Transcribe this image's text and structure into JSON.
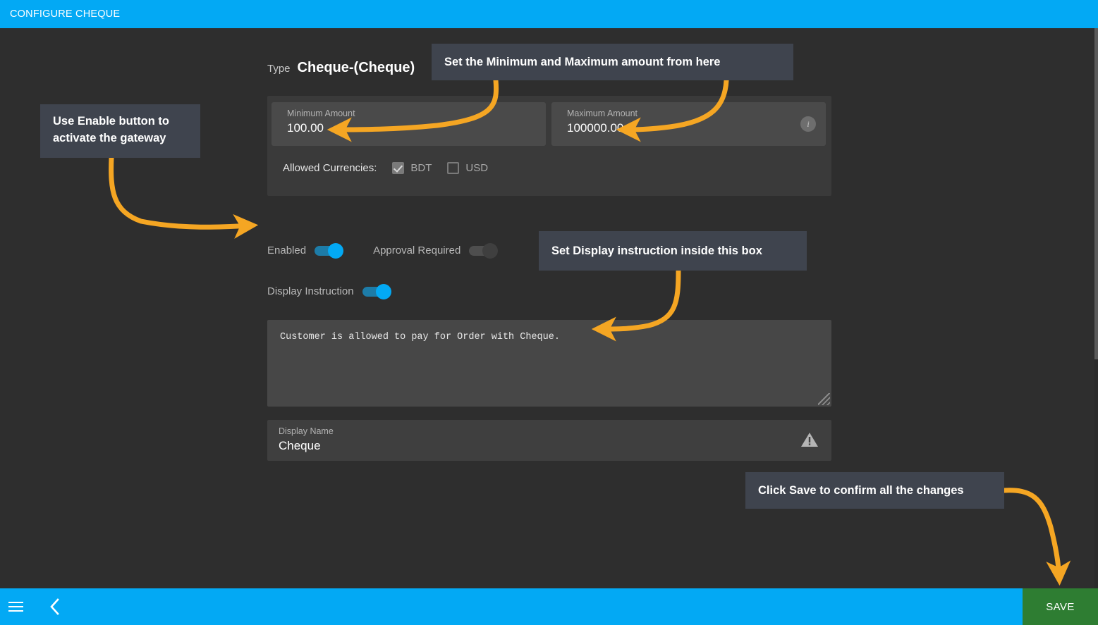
{
  "topbar": {
    "title": "CONFIGURE CHEQUE"
  },
  "form": {
    "type_label": "Type",
    "type_value": "Cheque-(Cheque)",
    "minimum": {
      "label": "Minimum Amount",
      "value": "100.00"
    },
    "maximum": {
      "label": "Maximum Amount",
      "value": "100000.00",
      "info_icon": "info-icon",
      "info_glyph": "i"
    },
    "currencies": {
      "label": "Allowed Currencies:",
      "options": [
        {
          "code": "BDT",
          "checked": true
        },
        {
          "code": "USD",
          "checked": false
        }
      ]
    },
    "toggles": [
      {
        "label": "Enabled",
        "state": "on"
      },
      {
        "label": "Approval Required",
        "state": "off"
      },
      {
        "label": "Display Instruction",
        "state": "on"
      }
    ],
    "instruction": {
      "value": "Customer is allowed to pay for Order with Cheque.",
      "placeholder": "Display Instruction",
      "resize_grip": "resize-grip-icon"
    },
    "display_name": {
      "label": "Display Name",
      "value": "Cheque",
      "warning_icon": "warning-triangle-icon"
    }
  },
  "callouts": {
    "enable": "Use Enable button to activate the gateway",
    "minmax": "Set the Minimum and Maximum amount from here",
    "display": "Set Display instruction inside this box",
    "save": "Click Save to confirm all the changes"
  },
  "bottombar": {
    "menu_icon": "hamburger-menu-icon",
    "back_icon": "chevron-left-icon",
    "save_label": "SAVE"
  },
  "colors": {
    "accent_blue": "#03a9f4",
    "save_green": "#2e7d32",
    "annotation_orange": "#f5a623",
    "callout_bg": "#3f444e",
    "page_bg": "#2e2e2e"
  }
}
